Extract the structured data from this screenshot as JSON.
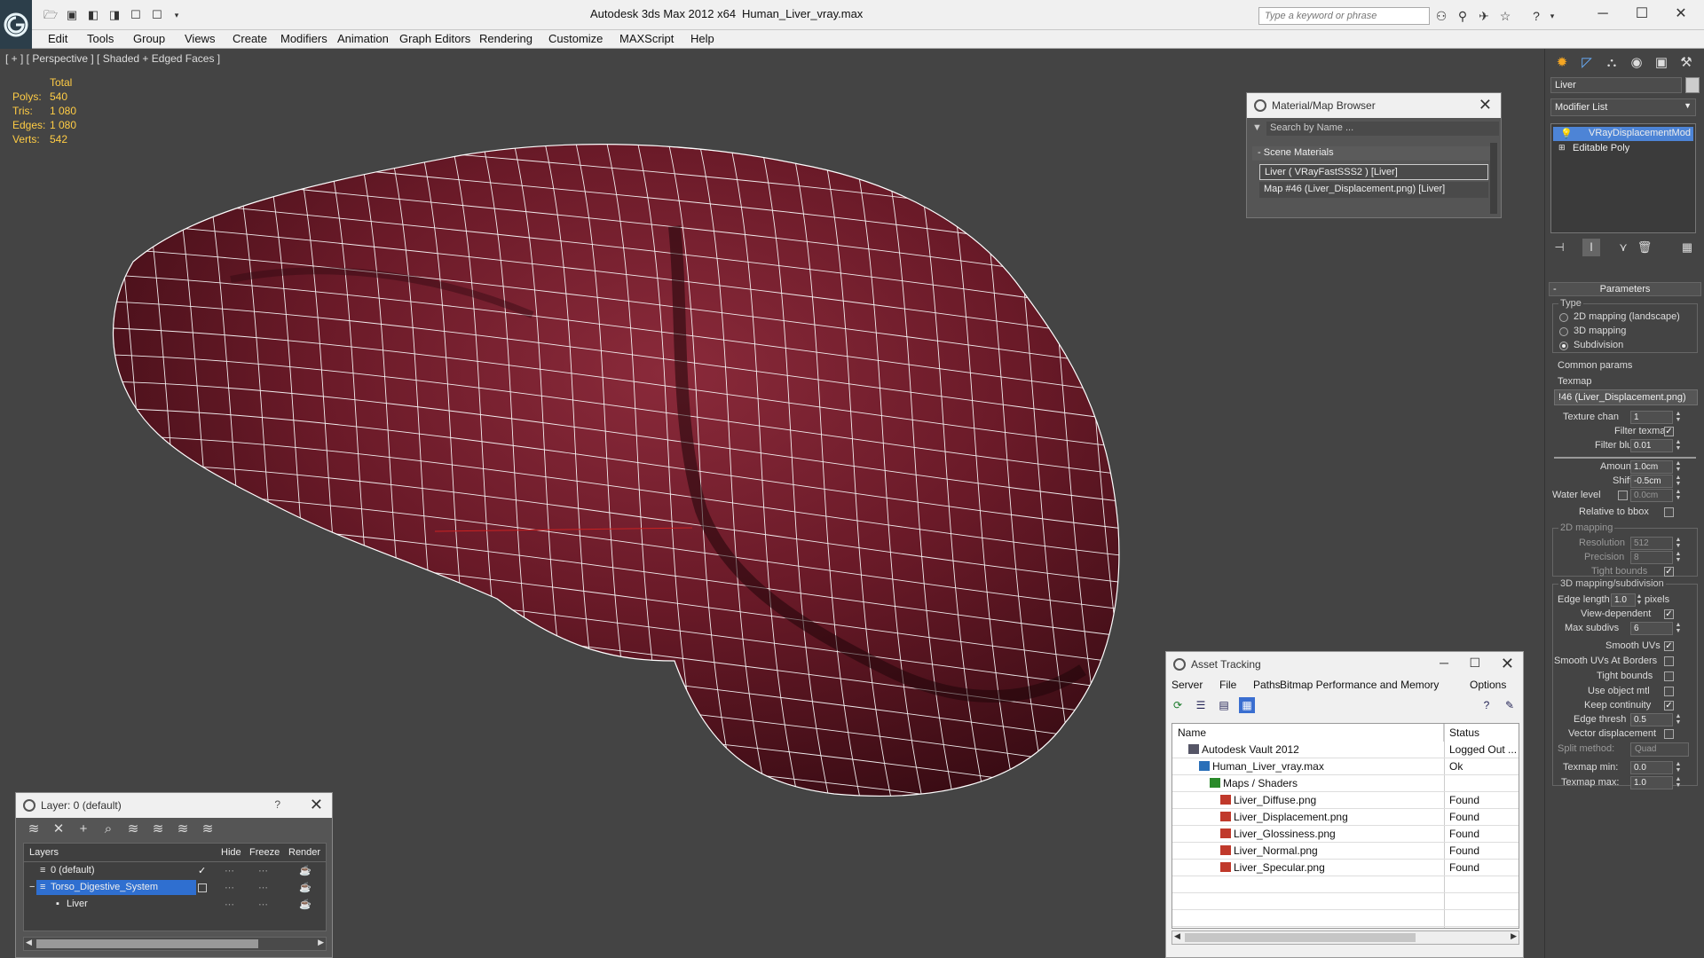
{
  "titlebar": {
    "app_title": "Autodesk 3ds Max  2012 x64",
    "file_name": "Human_Liver_vray.max",
    "search_placeholder": "Type a keyword or phrase"
  },
  "menu": [
    "Edit",
    "Tools",
    "Group",
    "Views",
    "Create",
    "Modifiers",
    "Animation",
    "Graph Editors",
    "Rendering",
    "Customize",
    "MAXScript",
    "Help"
  ],
  "viewport": {
    "label": "[ + ] [ Perspective ] [ Shaded + Edged Faces ]",
    "stats": {
      "header": "Total",
      "rows": [
        {
          "label": "Polys:",
          "value": "540"
        },
        {
          "label": "Tris:",
          "value": "1 080"
        },
        {
          "label": "Edges:",
          "value": "1 080"
        },
        {
          "label": "Verts:",
          "value": "542"
        }
      ]
    },
    "colors": {
      "background": "#444444",
      "mesh": "#6a1a28",
      "wire": "#ffffff",
      "stats": "#ffcc44"
    }
  },
  "material_browser": {
    "title": "Material/Map Browser",
    "search_placeholder": "Search by Name ...",
    "group": "Scene Materials",
    "group_toggle": "-",
    "items": [
      "Liver  ( VRayFastSSS2 )  [Liver]",
      "Map #46 (Liver_Displacement.png)  [Liver]"
    ]
  },
  "layer_dialog": {
    "title": "Layer: 0 (default)",
    "help": "?",
    "columns": [
      "Layers",
      "Hide",
      "Freeze",
      "Render"
    ],
    "rows": [
      {
        "name": "0 (default)",
        "active": true
      },
      {
        "name": "Torso_Digestive_System",
        "selected": true
      },
      {
        "name": "Liver",
        "child": true
      }
    ]
  },
  "asset_tracking": {
    "title": "Asset Tracking",
    "menu": [
      "Server",
      "File",
      "Paths",
      "Bitmap Performance and Memory",
      "Options"
    ],
    "columns": [
      "Name",
      "Status"
    ],
    "rows": [
      {
        "name": "Autodesk Vault 2012",
        "status": "Logged Out ...",
        "indent": 1,
        "icon": "vault-icon"
      },
      {
        "name": "Human_Liver_vray.max",
        "status": "Ok",
        "indent": 2,
        "icon": "max-file-icon"
      },
      {
        "name": "Maps / Shaders",
        "status": "",
        "indent": 3,
        "icon": "maps-icon"
      },
      {
        "name": "Liver_Diffuse.png",
        "status": "Found",
        "indent": 4,
        "icon": "png-icon"
      },
      {
        "name": "Liver_Displacement.png",
        "status": "Found",
        "indent": 4,
        "icon": "png-icon"
      },
      {
        "name": "Liver_Glossiness.png",
        "status": "Found",
        "indent": 4,
        "icon": "png-icon"
      },
      {
        "name": "Liver_Normal.png",
        "status": "Found",
        "indent": 4,
        "icon": "png-icon"
      },
      {
        "name": "Liver_Specular.png",
        "status": "Found",
        "indent": 4,
        "icon": "png-icon"
      }
    ]
  },
  "command_panel": {
    "object_name": "Liver",
    "modifier_list": "Modifier List",
    "stack": [
      "VRayDisplacementMod",
      "Editable Poly"
    ],
    "rollout": "Parameters",
    "rollout_toggle": "-",
    "type_group": "Type",
    "type_options": [
      "2D mapping (landscape)",
      "3D mapping",
      "Subdivision"
    ],
    "type_selected": 2,
    "common_params": "Common params",
    "texmap_label": "Texmap",
    "texmap_value": "!46 (Liver_Displacement.png)",
    "texture_chan": {
      "label": "Texture chan",
      "value": "1"
    },
    "filter_texmap": {
      "label": "Filter texmap",
      "checked": true
    },
    "filter_blur": {
      "label": "Filter blur",
      "value": "0.01"
    },
    "amount": {
      "label": "Amount",
      "value": "1.0cm"
    },
    "shift": {
      "label": "Shift",
      "value": "-0.5cm"
    },
    "water_level": {
      "label": "Water level",
      "value": "0.0cm",
      "checked": false
    },
    "relative_bbox": {
      "label": "Relative to bbox",
      "checked": false
    },
    "mapping2d_group": "2D mapping",
    "resolution": {
      "label": "Resolution",
      "value": "512"
    },
    "precision": {
      "label": "Precision",
      "value": "8"
    },
    "tight_bounds_2d": {
      "label": "Tight bounds",
      "checked": true
    },
    "mapping3d_group": "3D mapping/subdivision",
    "edge_length": {
      "label": "Edge length",
      "value": "1.0",
      "unit": "pixels"
    },
    "view_dependent": {
      "label": "View-dependent",
      "checked": true
    },
    "max_subdivs": {
      "label": "Max subdivs",
      "value": "6"
    },
    "smooth_uvs": {
      "label": "Smooth UVs",
      "checked": true
    },
    "smooth_uvs_borders": {
      "label": "Smooth UVs At Borders",
      "checked": false
    },
    "tight_bounds_3d": {
      "label": "Tight bounds",
      "checked": false
    },
    "use_object_mtl": {
      "label": "Use object mtl",
      "checked": false
    },
    "keep_continuity": {
      "label": "Keep continuity",
      "checked": true
    },
    "edge_thresh": {
      "label": "Edge thresh",
      "value": "0.5"
    },
    "vector_displacement": {
      "label": "Vector displacement",
      "checked": false
    },
    "split_method": {
      "label": "Split method:",
      "value": "Quad"
    },
    "texmap_min": {
      "label": "Texmap min:",
      "value": "0.0"
    },
    "texmap_max": {
      "label": "Texmap max:",
      "value": "1.0"
    }
  }
}
